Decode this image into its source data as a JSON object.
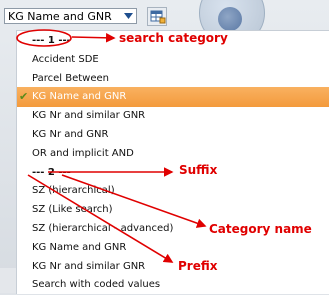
{
  "combo": {
    "value": "KG Name and GNR"
  },
  "list": {
    "items": [
      {
        "label": "--- 1 ---",
        "kind": "header"
      },
      {
        "label": "Accident SDE",
        "kind": "item"
      },
      {
        "label": "Parcel Between",
        "kind": "item"
      },
      {
        "label": "KG Name and GNR",
        "kind": "selected"
      },
      {
        "label": "KG Nr and similar GNR",
        "kind": "item"
      },
      {
        "label": "KG Nr and GNR",
        "kind": "item"
      },
      {
        "label": "OR and implicit AND",
        "kind": "item"
      },
      {
        "label": "--- 2 ---",
        "kind": "header"
      },
      {
        "label": "SZ (hierarchical)",
        "kind": "item"
      },
      {
        "label": "SZ (Like search)",
        "kind": "item"
      },
      {
        "label": "SZ (hierarchical - advanced)",
        "kind": "item"
      },
      {
        "label": "KG Name and GNR",
        "kind": "item"
      },
      {
        "label": "KG Nr and similar GNR",
        "kind": "item"
      },
      {
        "label": "Search with coded values",
        "kind": "item"
      }
    ]
  },
  "annotations": {
    "search_category": "search category",
    "suffix": "Suffix",
    "category_name": "Category name",
    "prefix": "Prefix"
  },
  "colors": {
    "selected": "#f39a3c",
    "annotation": "#e00000",
    "check": "#5a8a1a"
  },
  "icons": {
    "dropdown_arrow": "chevron-down-icon",
    "tool_button": "table-icon",
    "selected_mark": "check-icon"
  }
}
